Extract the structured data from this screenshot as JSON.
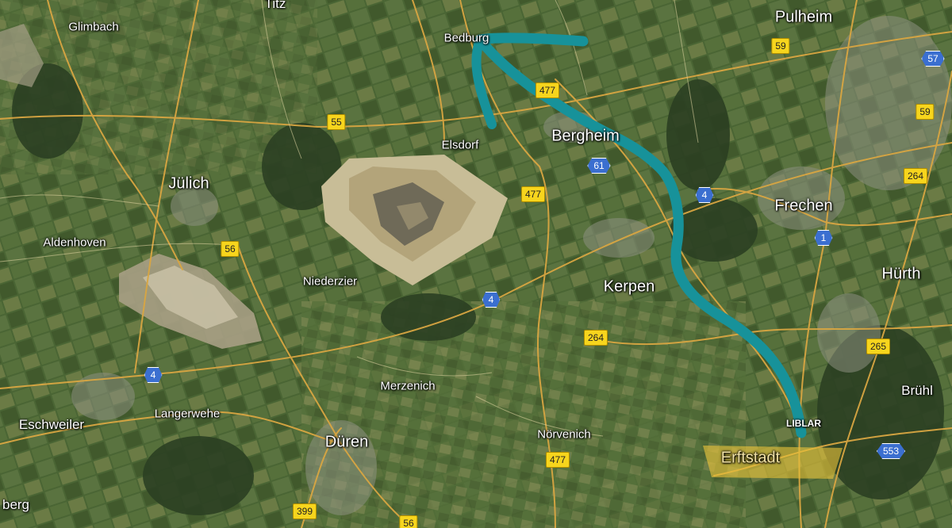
{
  "map": {
    "places": [
      {
        "id": "titz",
        "name": "Titz"
      },
      {
        "id": "glimbach",
        "name": "Glimbach"
      },
      {
        "id": "bedburg",
        "name": "Bedburg"
      },
      {
        "id": "pulheim",
        "name": "Pulheim"
      },
      {
        "id": "elsdorf",
        "name": "Elsdorf"
      },
      {
        "id": "bergheim",
        "name": "Bergheim"
      },
      {
        "id": "julich",
        "name": "Jülich"
      },
      {
        "id": "aldenhoven",
        "name": "Aldenhoven"
      },
      {
        "id": "frechen",
        "name": "Frechen"
      },
      {
        "id": "niederzier",
        "name": "Niederzier"
      },
      {
        "id": "kerpen",
        "name": "Kerpen"
      },
      {
        "id": "hurth",
        "name": "Hürth"
      },
      {
        "id": "merzenich",
        "name": "Merzenich"
      },
      {
        "id": "bruhl",
        "name": "Brühl"
      },
      {
        "id": "eschweiler",
        "name": "Eschweiler"
      },
      {
        "id": "langerwehe",
        "name": "Langerwehe"
      },
      {
        "id": "liblar",
        "name": "LIBLAR"
      },
      {
        "id": "duren",
        "name": "Düren"
      },
      {
        "id": "norvenich",
        "name": "Nörvenich"
      },
      {
        "id": "berg",
        "name": "berg"
      }
    ],
    "highlight_label": "Erftstadt",
    "route_color": "#17929a",
    "highlight_color": "#e9c23a",
    "road_shields": [
      {
        "id": "s59a",
        "label": "59",
        "type": "yellow"
      },
      {
        "id": "s57",
        "label": "57",
        "type": "blue"
      },
      {
        "id": "s477a",
        "label": "477",
        "type": "yellow"
      },
      {
        "id": "s59b",
        "label": "59",
        "type": "yellow"
      },
      {
        "id": "s55",
        "label": "55",
        "type": "yellow"
      },
      {
        "id": "s61",
        "label": "61",
        "type": "blue"
      },
      {
        "id": "s264a",
        "label": "264",
        "type": "yellow"
      },
      {
        "id": "s477b",
        "label": "477",
        "type": "yellow"
      },
      {
        "id": "s4a",
        "label": "4",
        "type": "blue"
      },
      {
        "id": "s1",
        "label": "1",
        "type": "blue"
      },
      {
        "id": "s56a",
        "label": "56",
        "type": "yellow"
      },
      {
        "id": "s4b",
        "label": "4",
        "type": "blue"
      },
      {
        "id": "s264b",
        "label": "264",
        "type": "yellow"
      },
      {
        "id": "s265",
        "label": "265",
        "type": "yellow"
      },
      {
        "id": "s4c",
        "label": "4",
        "type": "blue"
      },
      {
        "id": "s553",
        "label": "553",
        "type": "blue"
      },
      {
        "id": "s477c",
        "label": "477",
        "type": "yellow"
      },
      {
        "id": "s399",
        "label": "399",
        "type": "yellow"
      },
      {
        "id": "s56b",
        "label": "56",
        "type": "yellow"
      }
    ]
  }
}
